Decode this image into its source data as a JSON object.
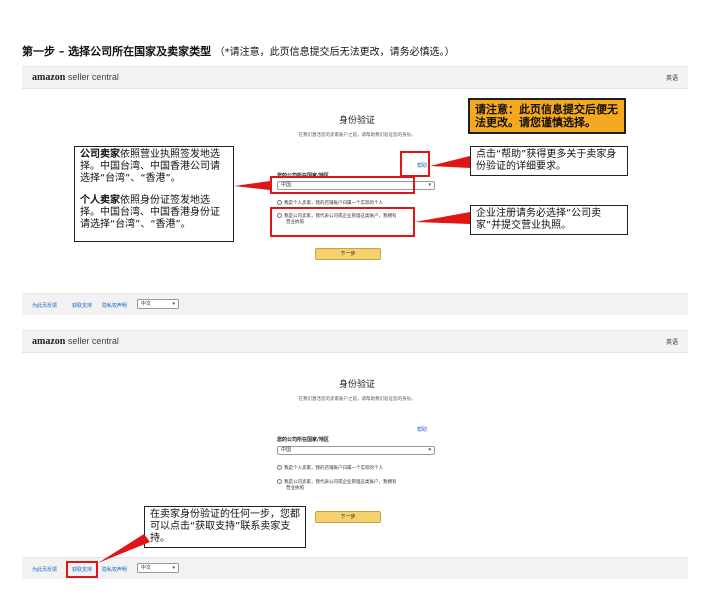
{
  "doc": {
    "title_bold": "第一步 – 选择公司所在国家及卖家类型",
    "title_note": "（*请注意，此页信息提交后无法更改，请务必慎选。）"
  },
  "brand": {
    "amazon": "amazon",
    "seller_central": "seller central"
  },
  "topbar": {
    "lang": "英语"
  },
  "panel": {
    "title": "身份验证",
    "description": "在我们激活您的卖家账户之前，请帮助我们验证您的身份。",
    "help_link": "帮助",
    "field_label": "您的公司所在国家/地区",
    "country_value": "中国",
    "radio_individual": "我是个人卖家，我的店铺账户归属一个实际的个人",
    "radio_business_line1": "我是公司卖家，我代表公司或企业管理这类账户，我拥有",
    "radio_business_line2": "营业执照",
    "next_button": "下一步"
  },
  "footer": {
    "link_help": "为此页反馈",
    "link_support": "获取支持",
    "link_privacy": "隐私权声明",
    "lang_value": "中文"
  },
  "callouts": {
    "warning": "请注意：此页信息提交后便无法更改。请您谨慎选择。",
    "company_bold": "公司卖家",
    "company_rest": "依照营业执照签发地选择。中国台湾、中国香港公司请选择“台湾”、“香港”。",
    "individual_bold": "个人卖家",
    "individual_rest": "依照身份证签发地选择。中国台湾、中国香港身份证请选择“台湾”、“香港”。",
    "help_tip": "点击“帮助”获得更多关于卖家身份验证的详细要求。",
    "business_tip": "企业注册请务必选择“公司卖家”并提交营业执照。",
    "support_tip": "在卖家身份验证的任何一步，您都可以点击“获取支持”联系卖家支持。"
  },
  "colors": {
    "annotation_red": "#e01515",
    "warning_orange": "#f6a821",
    "button_yellow": "#f5d170",
    "link_blue": "#1565c0"
  }
}
